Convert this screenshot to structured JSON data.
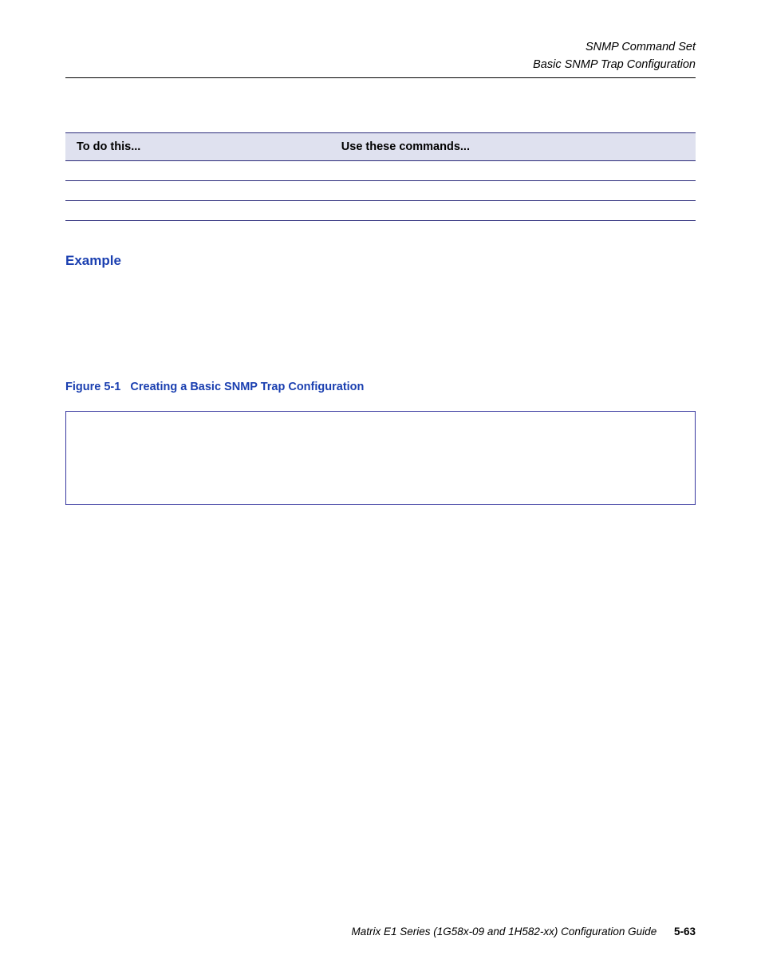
{
  "header": {
    "line1": "SNMP Command Set",
    "line2": "Basic SNMP Trap Configuration"
  },
  "table": {
    "col1_header": "To do this...",
    "col2_header": "Use these commands...",
    "rows": [
      {
        "todo": "",
        "cmd": ""
      },
      {
        "todo": "",
        "cmd": ""
      },
      {
        "todo": "",
        "cmd": ""
      }
    ]
  },
  "example": {
    "heading": "Example",
    "body": ""
  },
  "figure": {
    "label": "Figure 5-1",
    "title": "Creating a Basic SNMP Trap Configuration",
    "code": ""
  },
  "footer": {
    "text": "Matrix E1 Series (1G58x-09 and 1H582-xx) Configuration Guide",
    "page": "5-63"
  }
}
